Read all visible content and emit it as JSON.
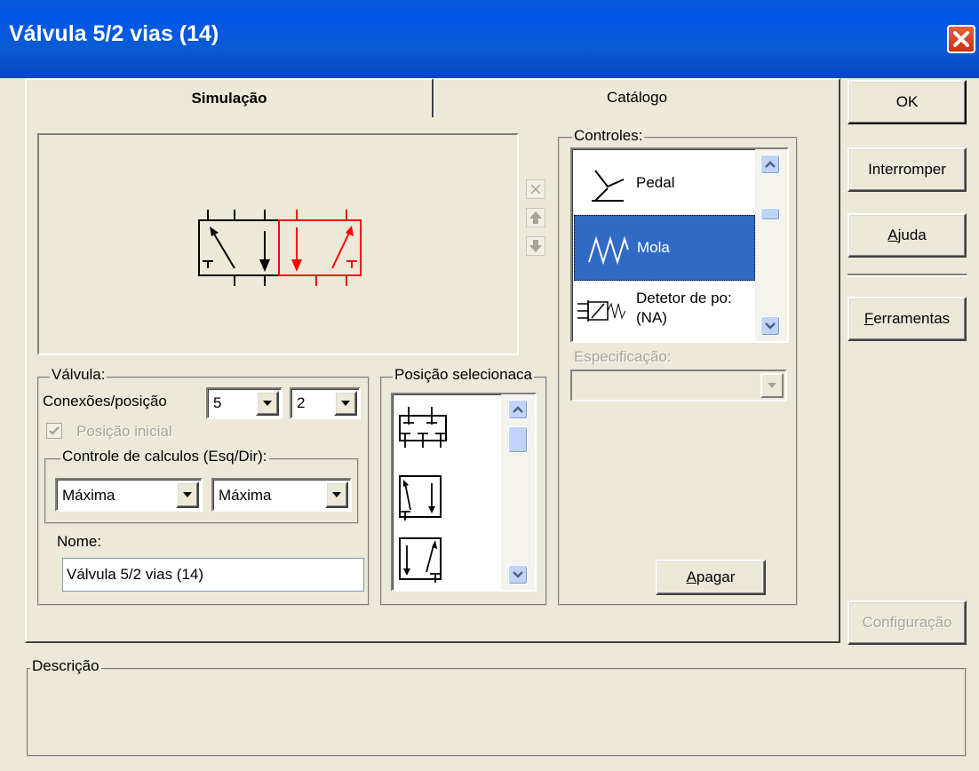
{
  "window": {
    "title": "Válvula 5/2 vias (14)"
  },
  "tabs": [
    {
      "label": "Simulação",
      "active": true
    },
    {
      "label": "Catálogo",
      "active": false
    }
  ],
  "buttons": {
    "ok": "OK",
    "interromper": "Interromper",
    "ajuda_u": "A",
    "ajuda_rest": "juda",
    "ferramentas_u": "F",
    "ferramentas_rest": "erramentas",
    "configuracao": "Configuração",
    "apagar_u": "A",
    "apagar_rest": "pagar"
  },
  "controles": {
    "legend": "Controles:",
    "items": [
      {
        "label": "Pedal",
        "icon": "pedal-icon",
        "selected": false
      },
      {
        "label": "Mola",
        "icon": "spring-icon",
        "selected": true
      },
      {
        "label": "Detetor de po:",
        "label2": "(NA)",
        "icon": "position-detector-icon",
        "selected": false
      }
    ],
    "especificacao_label": "Especificação:",
    "especificacao_value": ""
  },
  "valvula": {
    "legend": "Válvula:",
    "conexoes_label": "Conexões/posição",
    "conexoes_value": "5",
    "posicoes_value": "2",
    "posicao_inicial_label": "Posição inicial",
    "posicao_inicial_checked": true,
    "controle_legend": "Controle de calculos (Esq/Dir):",
    "controle_esq": "Máxima",
    "controle_dir": "Máxima",
    "nome_label": "Nome:",
    "nome_value": "Válvula 5/2 vias (14)"
  },
  "posicao": {
    "legend": "Posição selecionaca"
  },
  "descricao": {
    "legend": "Descrição",
    "text": ""
  },
  "colors": {
    "titlebar": "#0055EA",
    "selection": "#316AC5",
    "active_position": "#FF0000",
    "face": "#ECE9D8"
  }
}
